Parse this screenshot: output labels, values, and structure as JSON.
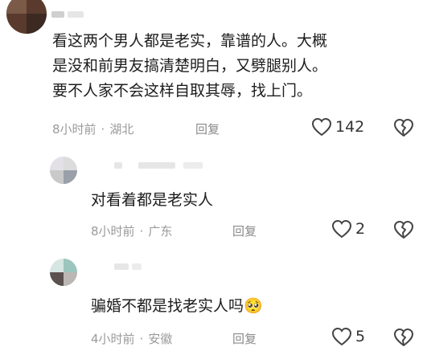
{
  "comments": [
    {
      "text": "看这两个男人都是老实，靠谱的人。大概是没和前男友搞清楚明白，又劈腿别人。要不人家不会这样自取其辱，找上门。",
      "lines": [
        "看这两个男人都是老实，靠谱的人。大概",
        "是没和前男友搞清楚明白，又劈腿别人。",
        "要不人家不会这样自取其辱，找上门。"
      ],
      "time": "8小时前",
      "location": "湖北",
      "reply_label": "回复",
      "likes": "142"
    },
    {
      "text": "对看着都是老实人",
      "time": "8小时前",
      "location": "广东",
      "reply_label": "回复",
      "likes": "2"
    },
    {
      "text": "骗婚不都是找老实人吗🥺",
      "time": "4小时前",
      "location": "安徽",
      "reply_label": "回复",
      "likes": "5"
    }
  ],
  "separator": "·",
  "icons": {
    "like": "heart-outline-icon",
    "dislike": "broken-heart-icon"
  }
}
